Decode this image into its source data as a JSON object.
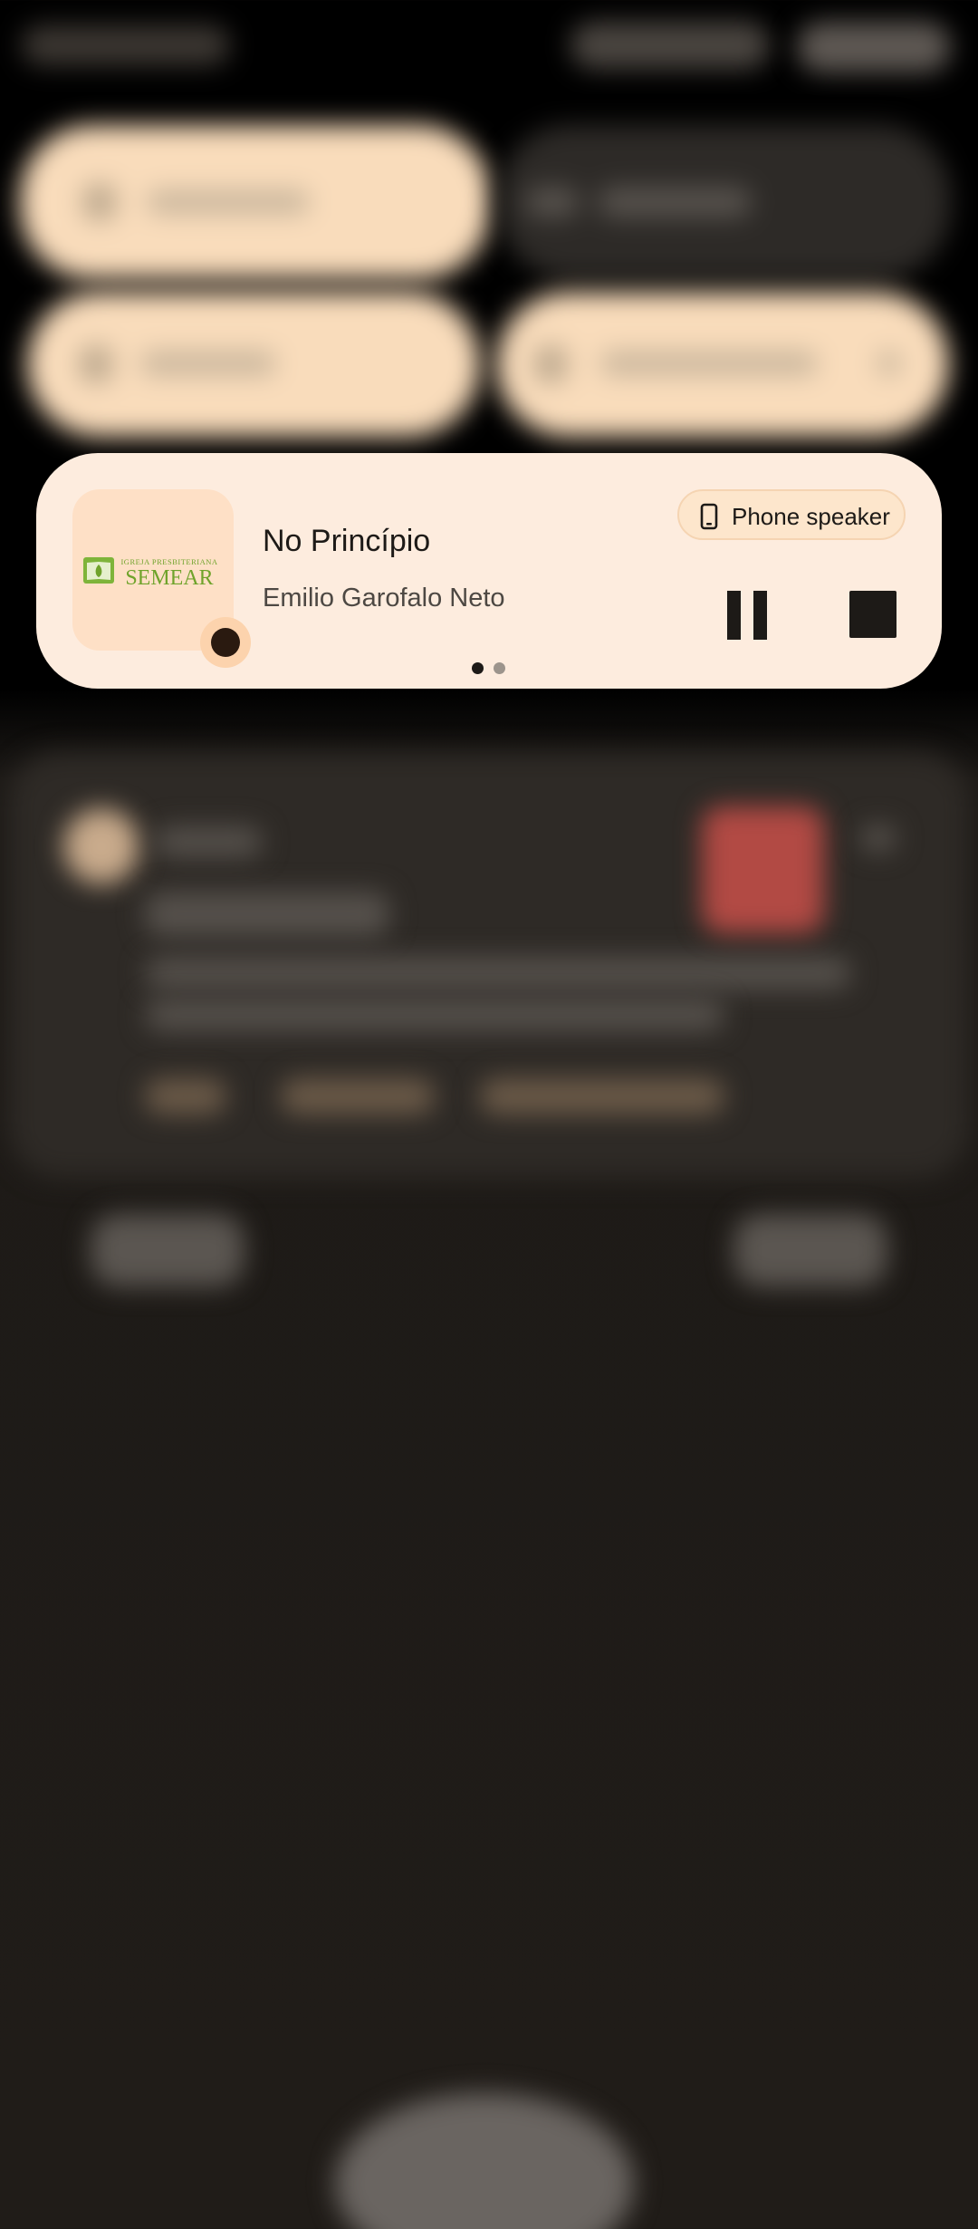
{
  "media": {
    "title": "No Princípio",
    "artist": "Emilio Garofalo Neto",
    "output_device": "Phone speaker",
    "output_icon": "phone-icon",
    "album_logo_small": "IGREJA PRESBITERIANA",
    "album_logo_large": "SEMEAR",
    "controls": [
      "pause",
      "stop"
    ],
    "page_count": 2,
    "current_page": 1
  },
  "colors": {
    "card_bg": "#fdecde",
    "album_bg": "#fee0c6",
    "logo_green": "#6fa32b",
    "tile_bg": "#f9dcbb",
    "background": "#201c18"
  }
}
